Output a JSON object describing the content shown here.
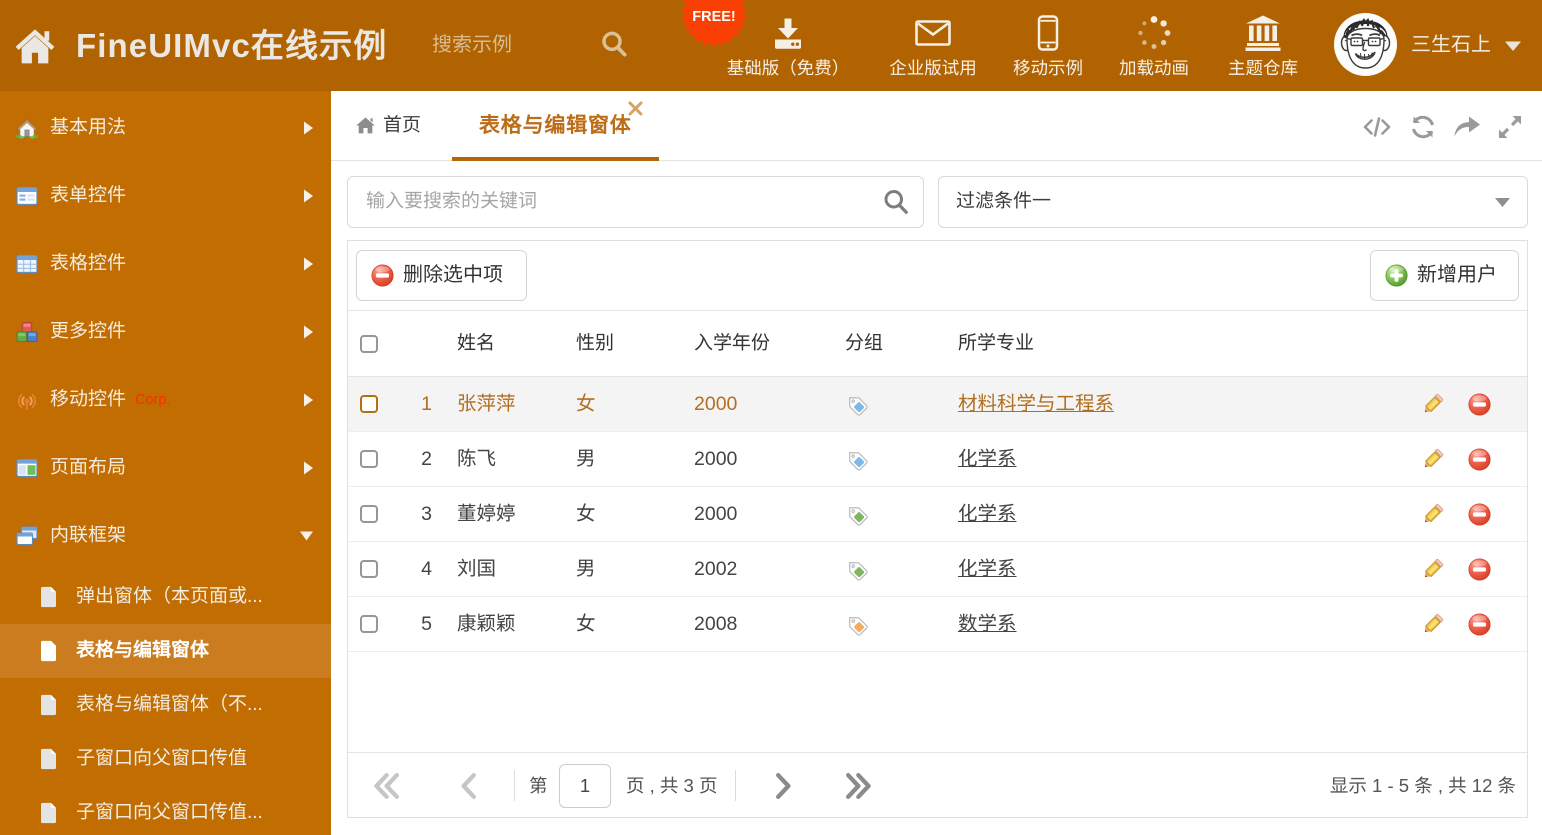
{
  "colors": {
    "header_bg": "#b06300",
    "sidebar_bg": "#c16d02",
    "sidebar_selected_bg": "#cb7c1e",
    "accent_orange": "#bd6c17",
    "tab_underline": "#b5660a",
    "badge_red": "#f83f04",
    "selected_row_bg": "#f4f4f4",
    "selected_row_text": "#b26f20"
  },
  "header": {
    "title": "FineUIMvc在线示例",
    "search_placeholder": "搜索示例",
    "badge": "FREE!",
    "nav": [
      {
        "label": "基础版（免费）",
        "icon": "download-icon"
      },
      {
        "label": "企业版试用",
        "icon": "envelope-icon"
      },
      {
        "label": "移动示例",
        "icon": "smartphone-icon"
      },
      {
        "label": "加载动画",
        "icon": "spinner-icon"
      },
      {
        "label": "主题仓库",
        "icon": "bank-icon"
      }
    ],
    "user": {
      "name": "三生石上",
      "avatar": "sketch-face-avatar"
    }
  },
  "sidebar": {
    "menu": [
      {
        "label": "基本用法",
        "icon": "house-icon"
      },
      {
        "label": "表单控件",
        "icon": "form-icon"
      },
      {
        "label": "表格控件",
        "icon": "table-icon"
      },
      {
        "label": "更多控件",
        "icon": "blocks-icon"
      },
      {
        "label": "移动控件",
        "badge": "Corp.",
        "icon": "signal-icon"
      },
      {
        "label": "页面布局",
        "icon": "layout-icon"
      },
      {
        "label": "内联框架",
        "icon": "frames-icon",
        "expanded": true
      }
    ],
    "submenu": [
      {
        "label": "弹出窗体（本页面或..."
      },
      {
        "label": "表格与编辑窗体",
        "selected": true
      },
      {
        "label": "表格与编辑窗体（不..."
      },
      {
        "label": "子窗口向父窗口传值"
      },
      {
        "label": "子窗口向父窗口传值..."
      }
    ]
  },
  "tabs": {
    "home_label": "首页",
    "active_label": "表格与编辑窗体",
    "toolbar_icons": [
      "code-icon",
      "refresh-icon",
      "share-icon",
      "expand-icon"
    ]
  },
  "filters": {
    "search_placeholder": "输入要搜索的关键词",
    "dropdown_value": "过滤条件一"
  },
  "toolbar": {
    "delete_label": "删除选中项",
    "add_label": "新增用户"
  },
  "table": {
    "columns": [
      "姓名",
      "性别",
      "入学年份",
      "分组",
      "所学专业"
    ],
    "rows": [
      {
        "num": "1",
        "name": "张萍萍",
        "gender": "女",
        "year": "2000",
        "tag": "blue",
        "major": "材料科学与工程系",
        "selected": true
      },
      {
        "num": "2",
        "name": "陈飞",
        "gender": "男",
        "year": "2000",
        "tag": "blue",
        "major": "化学系"
      },
      {
        "num": "3",
        "name": "董婷婷",
        "gender": "女",
        "year": "2000",
        "tag": "green",
        "major": "化学系"
      },
      {
        "num": "4",
        "name": "刘国",
        "gender": "男",
        "year": "2002",
        "tag": "green",
        "major": "化学系"
      },
      {
        "num": "5",
        "name": "康颖颖",
        "gender": "女",
        "year": "2008",
        "tag": "orange",
        "major": "数学系"
      }
    ]
  },
  "pagination": {
    "page_prefix": "第",
    "page_value": "1",
    "page_suffix": "页 , 共 3 页",
    "summary": "显示 1 - 5 条 , 共 12 条"
  }
}
